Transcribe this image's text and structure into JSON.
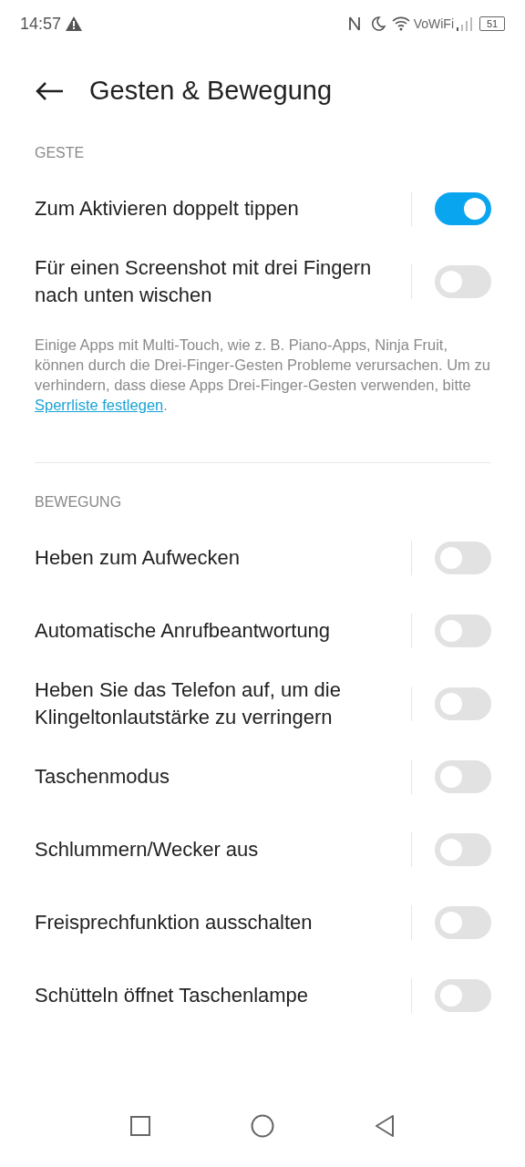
{
  "status_bar": {
    "time": "14:57",
    "network_label": "VoWiFi",
    "battery": "51"
  },
  "header": {
    "title": "Gesten & Bewegung"
  },
  "sections": [
    {
      "title": "GESTE",
      "items": [
        {
          "label": "Zum Aktivieren doppelt tippen",
          "on": true
        },
        {
          "label": "Für einen Screenshot mit drei Fingern nach unten wischen",
          "on": false
        }
      ],
      "note": {
        "text": "Einige Apps mit Multi-Touch, wie z. B. Piano-Apps, Ninja Fruit, können durch die Drei-Finger-Gesten Probleme verursachen. Um zu verhindern, dass diese Apps Drei-Finger-Gesten verwenden, bitte",
        "link": "Sperrliste festlegen",
        "after": "."
      }
    },
    {
      "title": "BEWEGUNG",
      "items": [
        {
          "label": "Heben zum Aufwecken",
          "on": false
        },
        {
          "label": "Automatische Anrufbeantwortung",
          "on": false
        },
        {
          "label": "Heben Sie das Telefon auf, um die Klingeltonlautstärke zu verringern",
          "on": false
        },
        {
          "label": "Taschenmodus",
          "on": false
        },
        {
          "label": "Schlummern/Wecker aus",
          "on": false
        },
        {
          "label": "Freisprechfunktion ausschalten",
          "on": false
        },
        {
          "label": "Schütteln öffnet Taschenlampe",
          "on": false
        }
      ]
    }
  ]
}
